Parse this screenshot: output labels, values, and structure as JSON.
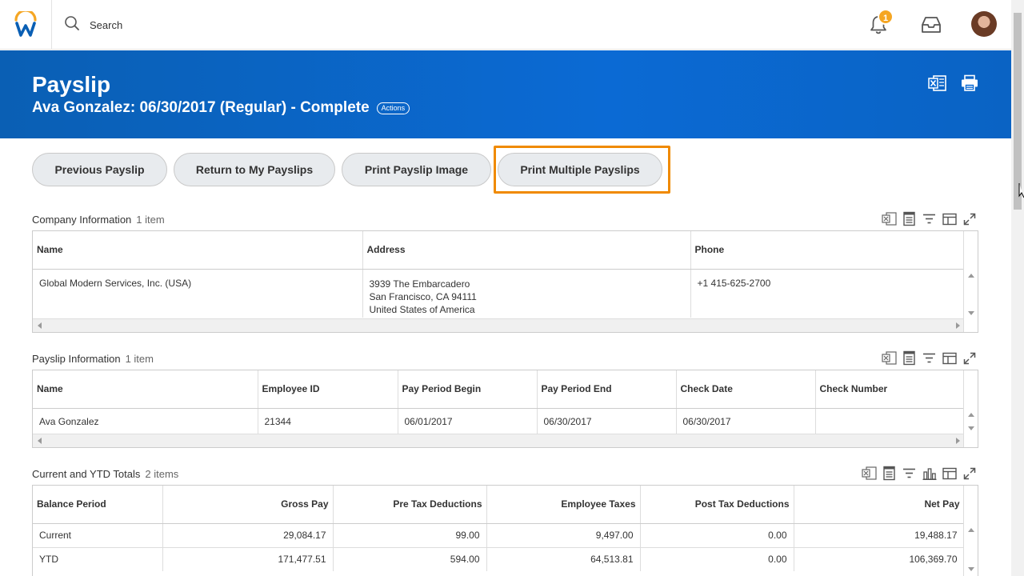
{
  "topbar": {
    "search_placeholder": "Search",
    "notification_count": "1"
  },
  "header": {
    "title": "Payslip",
    "subtitle": "Ava Gonzalez: 06/30/2017 (Regular) - Complete",
    "actions_label": "Actions"
  },
  "buttons": {
    "previous": "Previous Payslip",
    "return": "Return to My Payslips",
    "print_image": "Print Payslip Image",
    "print_multiple": "Print Multiple Payslips"
  },
  "company_info": {
    "title": "Company Information",
    "count": "1 item",
    "columns": [
      "Name",
      "Address",
      "Phone"
    ],
    "row": {
      "name": "Global Modern Services, Inc. (USA)",
      "address_line1": "3939 The Embarcadero",
      "address_line2": "San Francisco, CA 94111",
      "address_line3": "United States of America",
      "phone": "+1 415-625-2700"
    }
  },
  "payslip_info": {
    "title": "Payslip Information",
    "count": "1 item",
    "columns": [
      "Name",
      "Employee ID",
      "Pay Period Begin",
      "Pay Period End",
      "Check Date",
      "Check Number"
    ],
    "row": [
      "Ava Gonzalez",
      "21344",
      "06/01/2017",
      "06/30/2017",
      "06/30/2017",
      ""
    ]
  },
  "totals": {
    "title": "Current and YTD Totals",
    "count": "2 items",
    "columns": [
      "Balance Period",
      "Gross Pay",
      "Pre Tax Deductions",
      "Employee Taxes",
      "Post Tax Deductions",
      "Net Pay"
    ],
    "rows": [
      [
        "Current",
        "29,084.17",
        "99.00",
        "9,497.00",
        "0.00",
        "19,488.17"
      ],
      [
        "YTD",
        "171,477.51",
        "594.00",
        "64,513.81",
        "0.00",
        "106,369.70"
      ]
    ]
  },
  "colors": {
    "banner": "#0b6ad4",
    "highlight": "#f08a00",
    "badge": "#f5a623"
  }
}
